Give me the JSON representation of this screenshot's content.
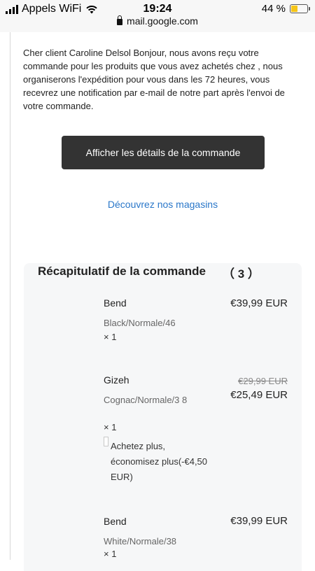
{
  "status": {
    "carrier": "Appels WiFi",
    "time": "19:24",
    "battery": "44 %",
    "battery_level": 0.44,
    "url": "mail.google.com"
  },
  "email": {
    "intro": "Cher client Caroline Delsol Bonjour, nous avons reçu votre commande pour les produits que vous avez achetés chez , nous organiserons l'expédition pour vous dans les 72 heures, vous recevrez une notification par e-mail de notre part après l'envoi de votre commande.",
    "details_button": "Afficher les détails de la commande",
    "stores_link": "Découvrez nos magasins"
  },
  "summary": {
    "title": "Récapitulatif de la commande",
    "count": "（ 3 ）",
    "items": [
      {
        "name": "Bend",
        "variant": "Black/Normale/46",
        "qty": "× 1",
        "price": "€39,99 EUR"
      },
      {
        "name": "Gizeh",
        "variant": "Cognac/Normale/3 8",
        "qty": "× 1",
        "old_price": "€29,99 EUR",
        "price": "€25,49 EUR",
        "promo": "Achetez plus, économisez plus(-€4,50 EUR)"
      },
      {
        "name": "Bend",
        "variant": "White/Normale/38",
        "qty": "× 1",
        "price": "€39,99 EUR"
      }
    ]
  }
}
